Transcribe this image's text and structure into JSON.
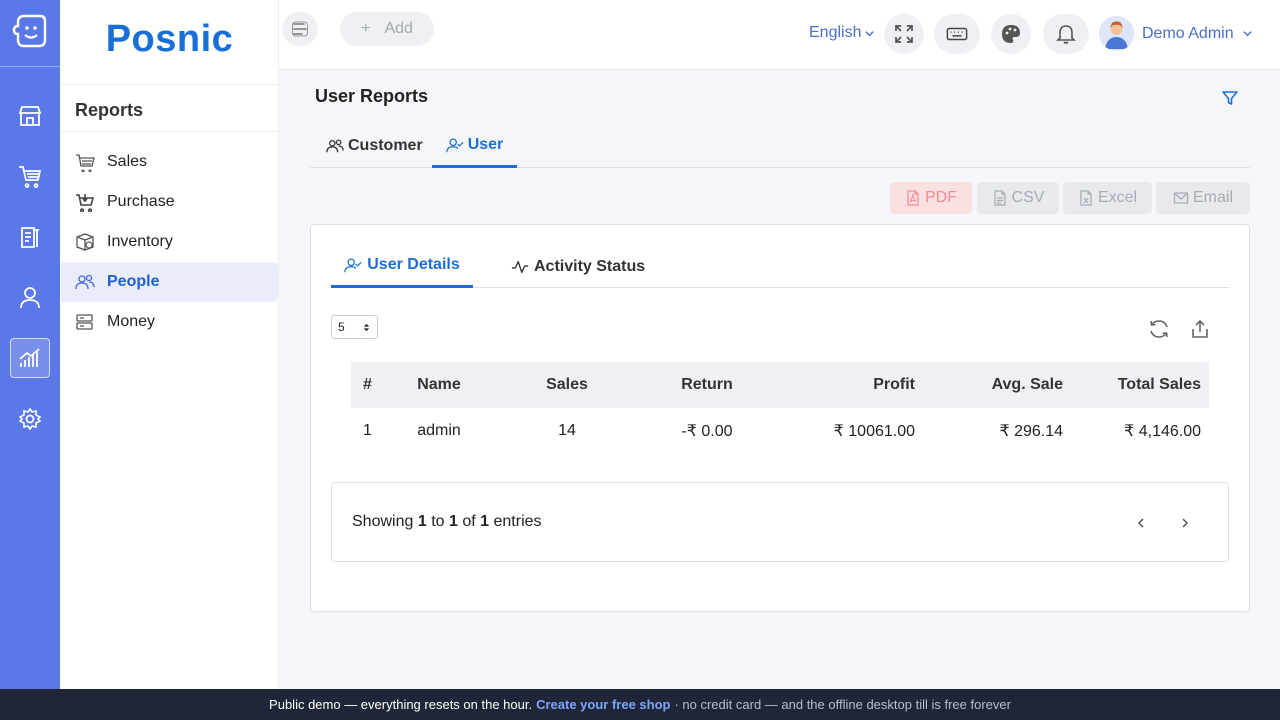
{
  "brand": {
    "name": "Posnic"
  },
  "rail": {
    "items": [
      {
        "name": "store-icon"
      },
      {
        "name": "cart-icon"
      },
      {
        "name": "clipboard-icon"
      },
      {
        "name": "person-icon"
      },
      {
        "name": "chart-icon",
        "active": true
      },
      {
        "name": "gear-icon"
      }
    ]
  },
  "sidebar": {
    "title": "Reports",
    "items": [
      {
        "label": "Sales",
        "icon": "basket-icon"
      },
      {
        "label": "Purchase",
        "icon": "cart-icon"
      },
      {
        "label": "Inventory",
        "icon": "box-icon"
      },
      {
        "label": "People",
        "icon": "people-icon",
        "active": true
      },
      {
        "label": "Money",
        "icon": "money-icon"
      }
    ]
  },
  "topbar": {
    "add_label": "Add",
    "add_icon": "+",
    "language": "English",
    "user_name": "Demo Admin"
  },
  "page": {
    "title": "User Reports",
    "tabs": [
      {
        "label": "Customer"
      },
      {
        "label": "User",
        "active": true
      }
    ],
    "exports": [
      {
        "label": "PDF"
      },
      {
        "label": "CSV"
      },
      {
        "label": "Excel"
      },
      {
        "label": "Email"
      }
    ]
  },
  "card": {
    "tabs": [
      {
        "label": "User Details",
        "active": true
      },
      {
        "label": "Activity Status"
      }
    ],
    "page_size": "5",
    "table": {
      "columns": [
        "#",
        "Name",
        "Sales",
        "Return",
        "Profit",
        "Avg. Sale",
        "Total Sales"
      ],
      "rows": [
        [
          "1",
          "admin",
          "14",
          "-₹ 0.00",
          "₹ 10061.00",
          "₹ 296.14",
          "₹ 4,146.00"
        ]
      ]
    },
    "pager": {
      "showing": "Showing",
      "from": "1",
      "to_word": "to",
      "to": "1",
      "of_word": "of",
      "total": "1",
      "entries": "entries"
    }
  },
  "banner": {
    "text": "Public demo — everything resets on the hour.",
    "link": "Create your free shop",
    "tail": "· no credit card — and the offline desktop till is free forever"
  },
  "colors": {
    "rail": "#5b78e8",
    "brand": "#1a6fd6",
    "accent": "#1f6fd1",
    "banner": "#1f2638"
  }
}
